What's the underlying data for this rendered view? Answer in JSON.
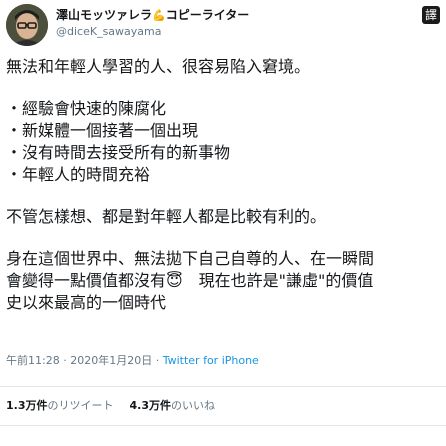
{
  "header": {
    "display_name": "澤山モッツァレラ",
    "name_emoji": "💪",
    "name_suffix": "コピーライター",
    "handle": "@diceK_sawayama",
    "brand_glyph": "譯"
  },
  "body": {
    "lines": [
      "無法和年輕人學習的人、很容易陷入窘境。",
      "",
      "・經驗會快速的陳腐化",
      "・新媒體一個接著一個出現",
      "・沒有時間去接受所有的新事物",
      "・年輕人的時間充裕",
      "",
      "不管怎樣想、都是對年輕人都是比較有利的。",
      "",
      "身在這個世界中、無法拋下自己自尊的人、在一瞬間",
      "會變得一點價值都沒有😇　現在也許是\"謙虛\"的價值",
      "史以來最高的一個時代"
    ]
  },
  "meta": {
    "time": "午前11:28",
    "separator": "·",
    "date": "2020年1月20日",
    "source": "Twitter for iPhone"
  },
  "stats": {
    "retweets_count": "1.3万件",
    "retweets_label": "のリツイート",
    "likes_count": "4.3万件",
    "likes_label": "のいいね"
  },
  "colors": {
    "text": "#14171a",
    "secondary": "#657786",
    "link": "#1b95e0",
    "divider": "#e1e8ed"
  }
}
